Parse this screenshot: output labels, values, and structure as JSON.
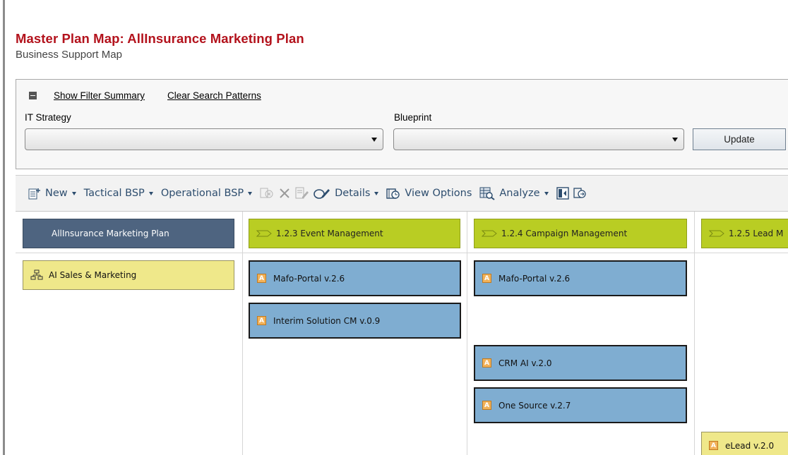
{
  "header": {
    "title": "Master Plan Map: AllInsurance Marketing Plan",
    "subtitle": "Business Support Map"
  },
  "filter": {
    "show_summary": "Show Filter Summary",
    "clear_patterns": "Clear Search Patterns",
    "it_strategy_label": "IT Strategy",
    "blueprint_label": "Blueprint",
    "update_label": "Update"
  },
  "toolbar": {
    "new": "New",
    "tactical": "Tactical BSP",
    "operational": "Operational BSP",
    "details": "Details",
    "view_options": "View Options",
    "analyze": "Analyze"
  },
  "map": {
    "plan": "AllInsurance Marketing Plan",
    "org_unit": "AI Sales & Marketing",
    "processes": [
      "1.2.3 Event Management",
      "1.2.4 Campaign Management",
      "1.2.5 Lead M"
    ],
    "col1_apps": [
      "Mafo-Portal v.2.6",
      "Interim Solution CM v.0.9"
    ],
    "col2_apps": [
      "Mafo-Portal v.2.6",
      "CRM AI v.2.0",
      "One Source v.2.7"
    ],
    "col3_apps": [
      "eLead v.2.0"
    ]
  },
  "colors": {
    "title": "#b3121c",
    "plan_box": "#4e6480",
    "process_box": "#b9cd23",
    "app_box": "#7fadd1",
    "org_box": "#efe88a"
  }
}
